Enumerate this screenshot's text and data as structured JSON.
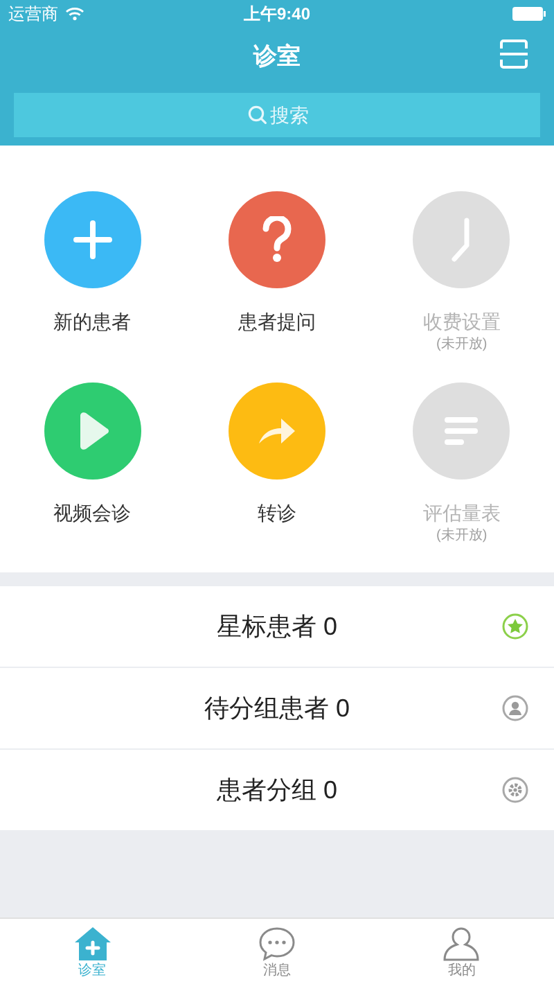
{
  "status_bar": {
    "carrier": "运营商",
    "time": "上午9:40"
  },
  "nav": {
    "title": "诊室"
  },
  "search": {
    "placeholder": "搜索"
  },
  "features": [
    {
      "label": "新的患者",
      "kind": "plus",
      "color": "#3bb9f5",
      "disabled": false
    },
    {
      "label": "患者提问",
      "kind": "question",
      "color": "#e8674f",
      "disabled": false
    },
    {
      "label": "收费设置",
      "note": "(未开放)",
      "kind": "clock",
      "color": "#dedede",
      "disabled": true
    },
    {
      "label": "视频会诊",
      "kind": "play",
      "color": "#2ecc71",
      "disabled": false
    },
    {
      "label": "转诊",
      "kind": "forward",
      "color": "#fdbb12",
      "disabled": false
    },
    {
      "label": "评估量表",
      "note": "(未开放)",
      "kind": "list",
      "color": "#dedede",
      "disabled": true
    }
  ],
  "groups": [
    {
      "label": "星标患者 0",
      "kind": "star"
    },
    {
      "label": "待分组患者 0",
      "kind": "person"
    },
    {
      "label": "患者分组 0",
      "kind": "gear"
    }
  ],
  "tabs": [
    {
      "label": "诊室",
      "kind": "home",
      "selected": true
    },
    {
      "label": "消息",
      "kind": "chat",
      "selected": false
    },
    {
      "label": "我的",
      "kind": "user",
      "selected": false
    }
  ]
}
